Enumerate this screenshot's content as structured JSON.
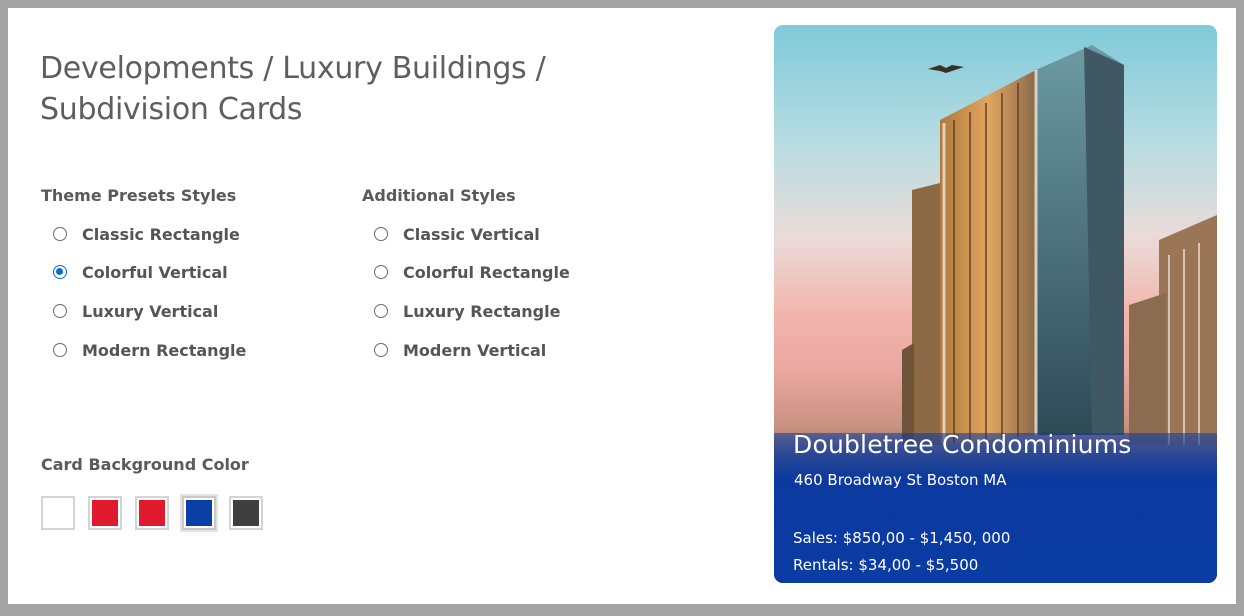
{
  "page": {
    "title": "Developments / Luxury Buildings / Subdivision Cards"
  },
  "theme_presets": {
    "label": "Theme Presets Styles",
    "options": [
      {
        "label": "Classic Rectangle",
        "checked": false
      },
      {
        "label": "Colorful Vertical",
        "checked": true
      },
      {
        "label": "Luxury Vertical",
        "checked": false
      },
      {
        "label": "Modern Rectangle",
        "checked": false
      }
    ]
  },
  "additional_styles": {
    "label": "Additional Styles",
    "options": [
      {
        "label": "Classic Vertical",
        "checked": false
      },
      {
        "label": "Colorful Rectangle",
        "checked": false
      },
      {
        "label": "Luxury Rectangle",
        "checked": false
      },
      {
        "label": "Modern Vertical",
        "checked": false
      }
    ]
  },
  "card_background": {
    "label": "Card Background Color",
    "swatches": [
      {
        "color": "#ffffff",
        "selected": false
      },
      {
        "color": "#e0192f",
        "selected": false
      },
      {
        "color": "#e0192f",
        "selected": false
      },
      {
        "color": "#0b3fa6",
        "selected": true
      },
      {
        "color": "#3f3f3f",
        "selected": false
      }
    ]
  },
  "card": {
    "name": "Doubletree Condominiums",
    "address": "460 Broadway St Boston MA",
    "sales": "Sales: $850,00 - $1,450, 000",
    "rentals": "Rentals: $34,00 - $5,500",
    "overlay_color": "#0a3ca3"
  }
}
